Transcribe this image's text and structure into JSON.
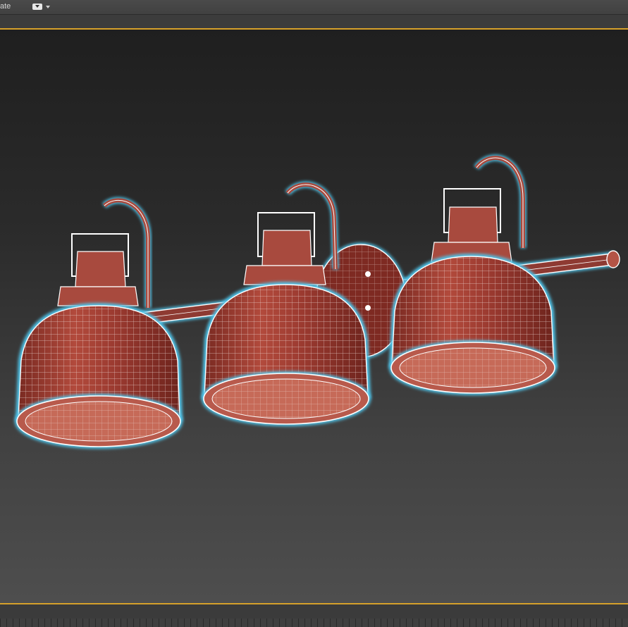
{
  "toolbar": {
    "label": "ate",
    "dropdown_icon": "display-mode-dropdown-icon"
  },
  "viewport": {
    "scene": "wireframe-vanity-light-three-shades",
    "colors": {
      "frame_accent": "#d6a12a",
      "mesh_fill": "#9a3a30",
      "mesh_wire": "#ffffff",
      "selection_glow": "#4fc3e8"
    }
  }
}
